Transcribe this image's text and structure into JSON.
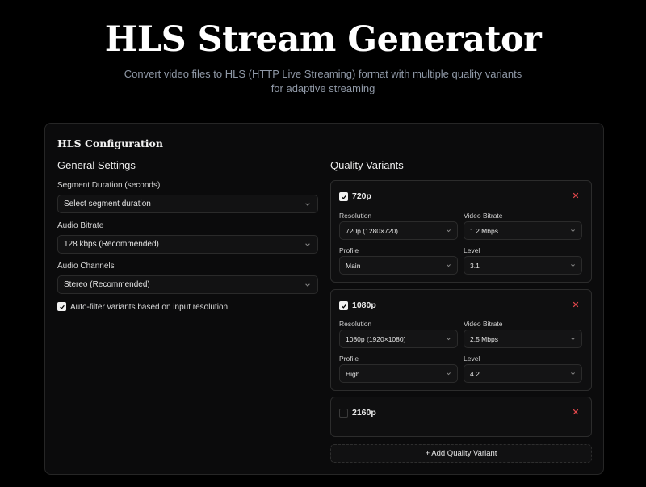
{
  "header": {
    "title": "HLS Stream Generator",
    "subtitle": "Convert video files to HLS (HTTP Live Streaming) format with multiple quality variants for adaptive streaming"
  },
  "config": {
    "title": "HLS Configuration",
    "general": {
      "title": "General Settings",
      "segment_duration": {
        "label": "Segment Duration (seconds)",
        "value": "Select segment duration"
      },
      "audio_bitrate": {
        "label": "Audio Bitrate",
        "value": "128 kbps (Recommended)"
      },
      "audio_channels": {
        "label": "Audio Channels",
        "value": "Stereo (Recommended)"
      },
      "auto_filter": {
        "label": "Auto-filter variants based on input resolution",
        "checked": true
      }
    },
    "quality": {
      "title": "Quality Variants",
      "field_labels": {
        "resolution": "Resolution",
        "video_bitrate": "Video Bitrate",
        "profile": "Profile",
        "level": "Level"
      },
      "variants": [
        {
          "name": "720p",
          "checked": true,
          "resolution": "720p (1280×720)",
          "video_bitrate": "1.2 Mbps",
          "profile": "Main",
          "level": "3.1"
        },
        {
          "name": "1080p",
          "checked": true,
          "resolution": "1080p (1920×1080)",
          "video_bitrate": "2.5 Mbps",
          "profile": "High",
          "level": "4.2"
        },
        {
          "name": "2160p",
          "checked": false
        }
      ],
      "add_label": "+ Add Quality Variant"
    }
  },
  "colors": {
    "accent_remove": "#e5484d",
    "background": "#000000",
    "card": "#0b0b0c"
  }
}
